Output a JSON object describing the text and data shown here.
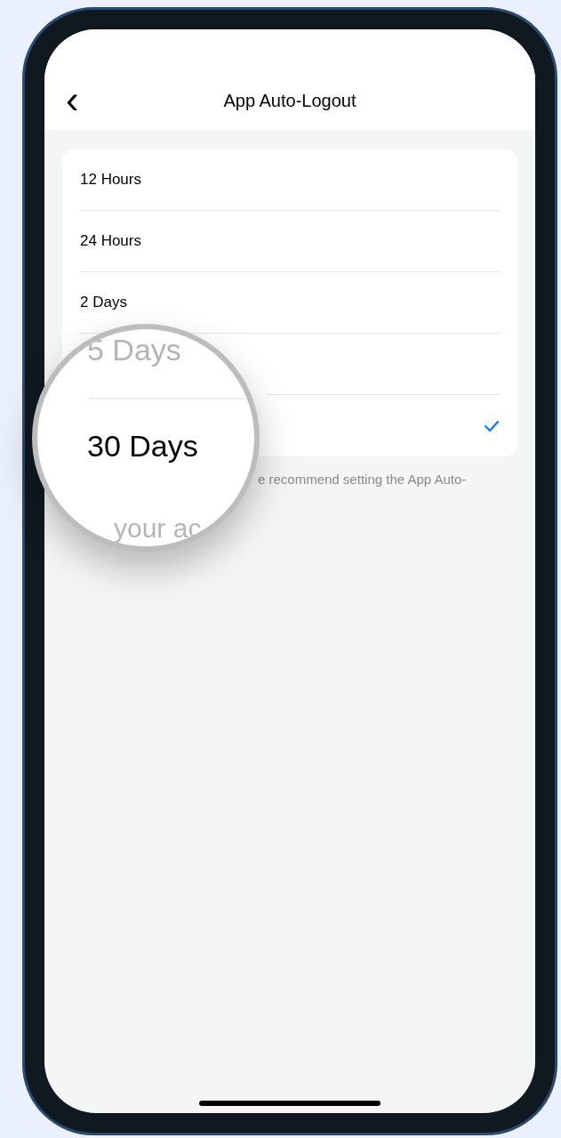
{
  "header": {
    "back": "‹",
    "title": "App Auto-Logout"
  },
  "options": [
    {
      "label": "12 Hours",
      "selected": false
    },
    {
      "label": "24 Hours",
      "selected": false
    },
    {
      "label": "2 Days",
      "selected": false
    },
    {
      "selected": false
    },
    {
      "selected": true
    }
  ],
  "footnote": "e recommend setting the App Auto-",
  "magnifier": {
    "lines": [
      {
        "text": "5 Days",
        "faded": true
      },
      {
        "text": "30 Days",
        "faded": false
      },
      {
        "text": "your ac",
        "faded": true
      }
    ]
  }
}
